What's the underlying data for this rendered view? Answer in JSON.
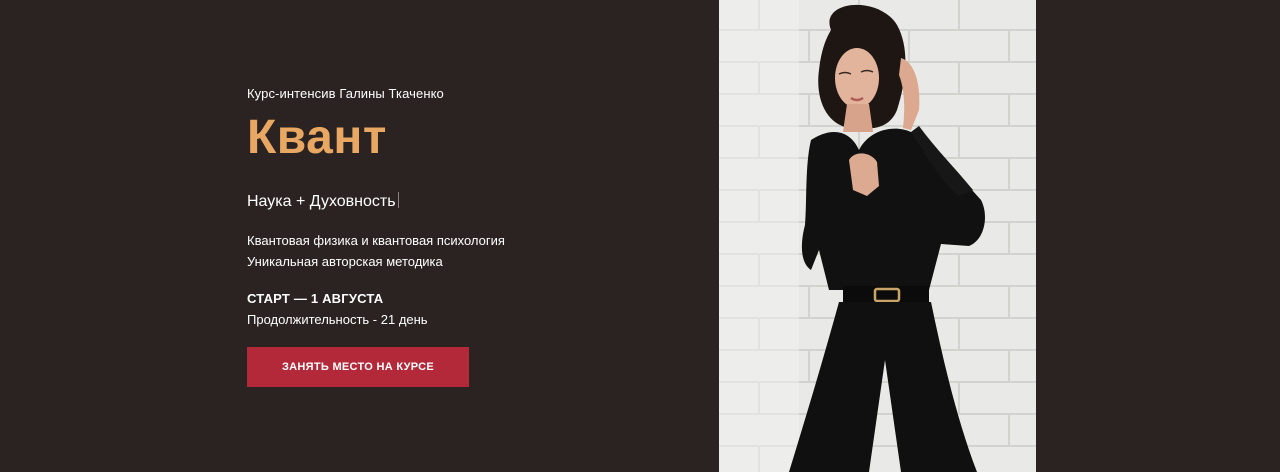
{
  "hero": {
    "eyebrow": "Курс-интенсив Галины Ткаченко",
    "title": "Квант",
    "tagline": "Наука + Духовность",
    "description_line1": "Квантовая физика и квантовая психология",
    "description_line2": "Уникальная авторская методика",
    "start": "СТАРТ — 1 АВГУСТА",
    "duration": "Продолжительность - 21 день",
    "cta_label": "ЗАНЯТЬ МЕСТО НА КУРСЕ"
  },
  "colors": {
    "background": "#2b2321",
    "accent_title": "#e8a762",
    "cta": "#b3293a",
    "text": "#ffffff"
  },
  "photo": {
    "icon": "portrait-photo"
  }
}
